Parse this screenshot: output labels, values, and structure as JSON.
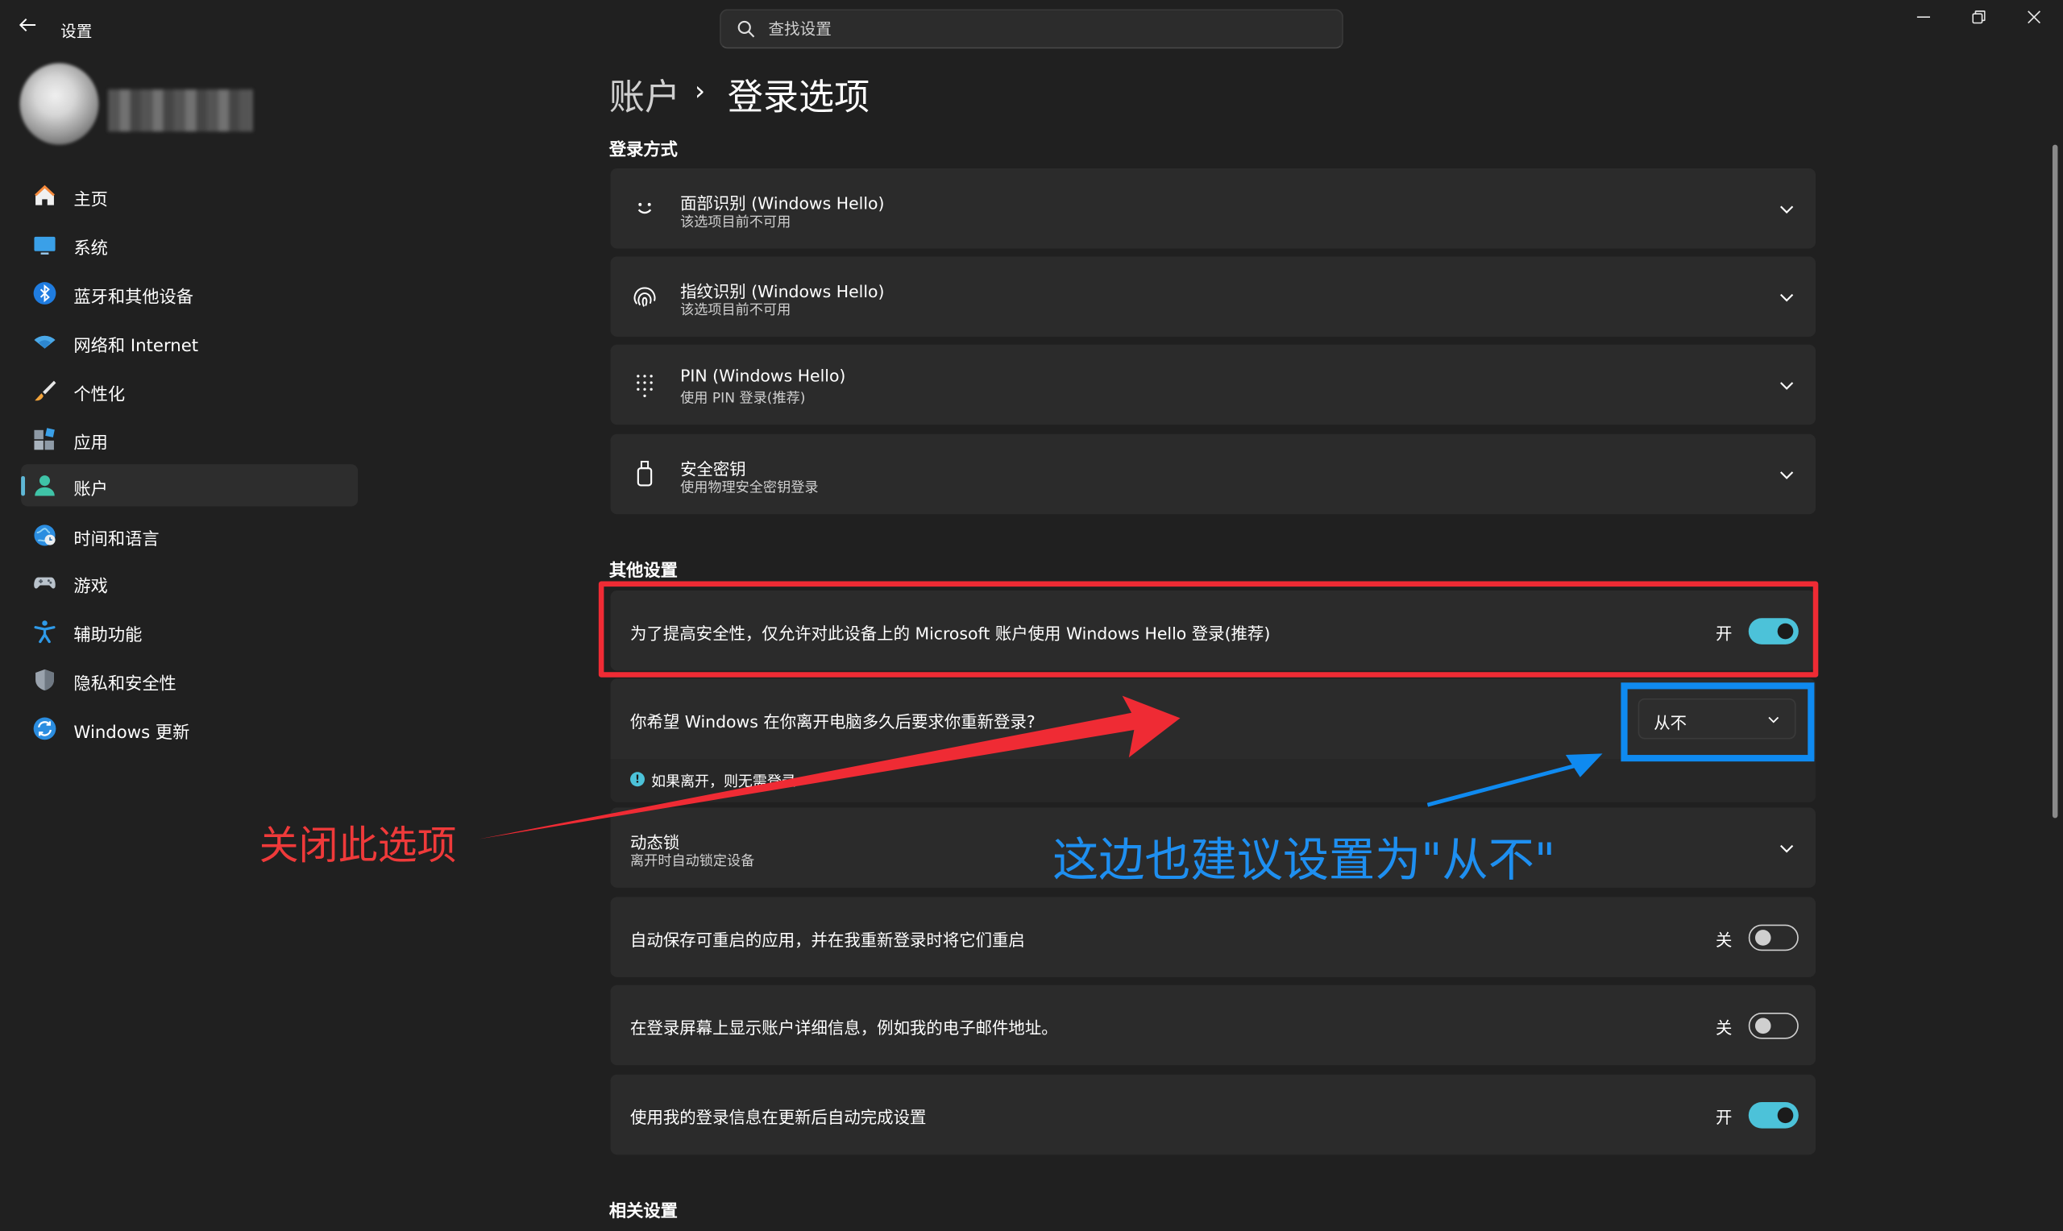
{
  "window": {
    "title": "设置",
    "controls": {
      "minimize": "—",
      "maximize": "▢",
      "close": "✕"
    }
  },
  "search": {
    "placeholder": "查找设置"
  },
  "sidebar": {
    "items": [
      {
        "label": "主页",
        "icon": "home-icon"
      },
      {
        "label": "系统",
        "icon": "system-icon"
      },
      {
        "label": "蓝牙和其他设备",
        "icon": "bluetooth-icon"
      },
      {
        "label": "网络和 Internet",
        "icon": "wifi-icon"
      },
      {
        "label": "个性化",
        "icon": "brush-icon"
      },
      {
        "label": "应用",
        "icon": "apps-icon"
      },
      {
        "label": "账户",
        "icon": "account-icon",
        "selected": true
      },
      {
        "label": "时间和语言",
        "icon": "globe-icon"
      },
      {
        "label": "游戏",
        "icon": "gamepad-icon"
      },
      {
        "label": "辅助功能",
        "icon": "accessibility-icon"
      },
      {
        "label": "隐私和安全性",
        "icon": "shield-icon"
      },
      {
        "label": "Windows 更新",
        "icon": "update-icon"
      }
    ]
  },
  "breadcrumb": {
    "parent": "账户",
    "separator": "›",
    "current": "登录选项"
  },
  "signin": {
    "heading": "登录方式",
    "methods": [
      {
        "title": "面部识别 (Windows Hello)",
        "subtitle": "该选项目前不可用",
        "icon": "face-icon"
      },
      {
        "title": "指纹识别 (Windows Hello)",
        "subtitle": "该选项目前不可用",
        "icon": "fingerprint-icon"
      },
      {
        "title": "PIN (Windows Hello)",
        "subtitle": "使用 PIN 登录(推荐)",
        "icon": "pin-keypad-icon"
      },
      {
        "title": "安全密钥",
        "subtitle": "使用物理安全密钥登录",
        "icon": "security-key-icon"
      }
    ]
  },
  "other": {
    "heading": "其他设置",
    "hello_only": {
      "text": "为了提高安全性，仅允许对此设备上的 Microsoft 账户使用 Windows Hello 登录(推荐)",
      "state": "开",
      "on": true
    },
    "require_signin": {
      "text": "你希望 Windows 在你离开电脑多久后要求你重新登录?",
      "value": "从不",
      "info": "如果离开，则无需登录"
    },
    "dynamic_lock": {
      "title": "动态锁",
      "subtitle": "离开时自动锁定设备"
    },
    "restart_apps": {
      "text": "自动保存可重启的应用，并在我重新登录时将它们重启",
      "state": "关",
      "on": false
    },
    "show_details": {
      "text": "在登录屏幕上显示账户详细信息，例如我的电子邮件地址。",
      "state": "关",
      "on": false
    },
    "use_signin_info": {
      "text": "使用我的登录信息在更新后自动完成设置",
      "state": "开",
      "on": true
    }
  },
  "related": {
    "heading": "相关设置"
  },
  "annotations": {
    "red_text": "关闭此选项",
    "blue_text": "这边也建议设置为\"从不\"",
    "red_color": "#ef2b34",
    "blue_color": "#0f8af0"
  },
  "colors": {
    "accent": "#4cc2d9",
    "background": "#202020",
    "card": "#2b2b2b"
  }
}
